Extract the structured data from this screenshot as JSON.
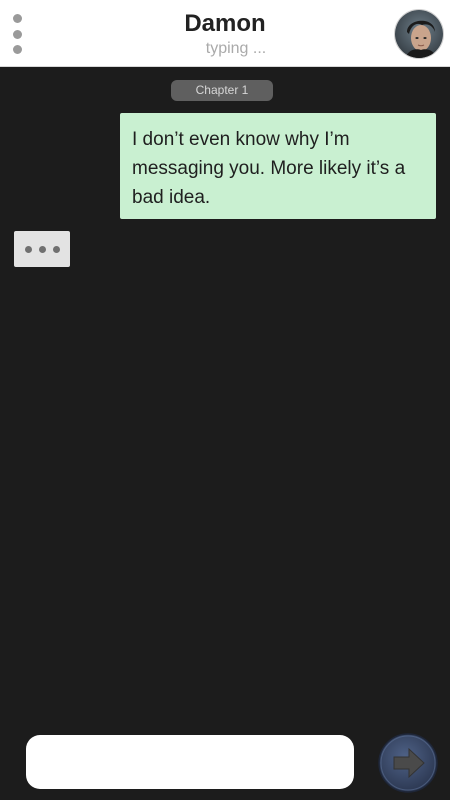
{
  "header": {
    "contact_name": "Damon",
    "status": "typing ..."
  },
  "chat": {
    "chapter_label": "Chapter 1",
    "messages": [
      {
        "direction": "outgoing",
        "text": "I don’t even know why I’m messaging you. More likely it’s a bad idea."
      }
    ],
    "typing_indicator": true
  },
  "composer": {
    "input_value": "",
    "input_placeholder": "",
    "send_icon": "arrow-right-icon"
  },
  "colors": {
    "header_bg": "#ffffff",
    "chat_bg": "#1c1c1c",
    "outgoing_bubble": "#c9f0d1",
    "typing_bubble": "#e3e3e3",
    "send_button": "#3a4a6b"
  }
}
